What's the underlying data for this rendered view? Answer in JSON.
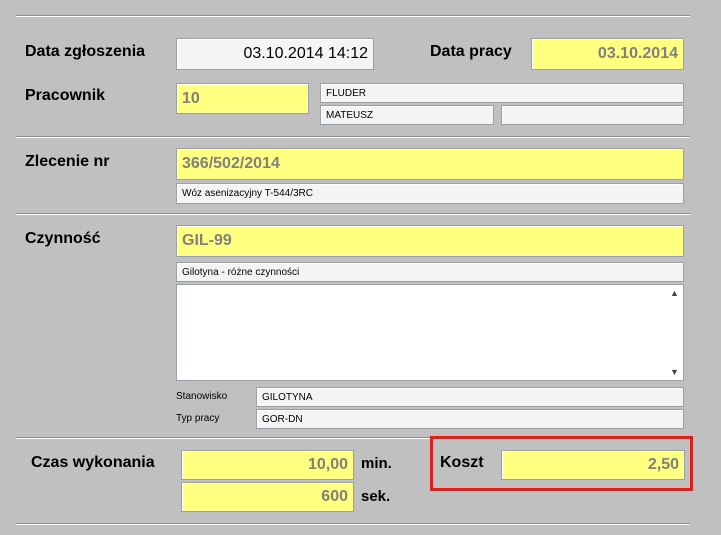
{
  "header": {
    "data_zgloszenia_label": "Data zgłoszenia",
    "data_zgloszenia_value": "03.10.2014 14:12",
    "data_pracy_label": "Data pracy",
    "data_pracy_value": "03.10.2014"
  },
  "pracownik": {
    "label": "Pracownik",
    "id": "10",
    "surname": "FLUDER",
    "first_name": "MATEUSZ",
    "extra": ""
  },
  "zlecenie": {
    "label": "Zlecenie nr",
    "number": "366/502/2014",
    "description": "Wóz asenizacyjny T-544/3RC"
  },
  "czynnosc": {
    "label": "Czynność",
    "code": "GIL-99",
    "name": "Gilotyna - różne czynności",
    "notes": "",
    "stanowisko_label": "Stanowisko",
    "stanowisko_value": "GILOTYNA",
    "typ_pracy_label": "Typ pracy",
    "typ_pracy_value": "GOR-DN"
  },
  "czas": {
    "label": "Czas wykonania",
    "minutes": "10,00",
    "minutes_unit": "min.",
    "seconds": "600",
    "seconds_unit": "sek."
  },
  "koszt": {
    "label": "Koszt",
    "value": "2,50"
  },
  "colors": {
    "highlight": "#d9201c",
    "field_yellow": "#ffff80",
    "background": "#c0c0c0"
  }
}
